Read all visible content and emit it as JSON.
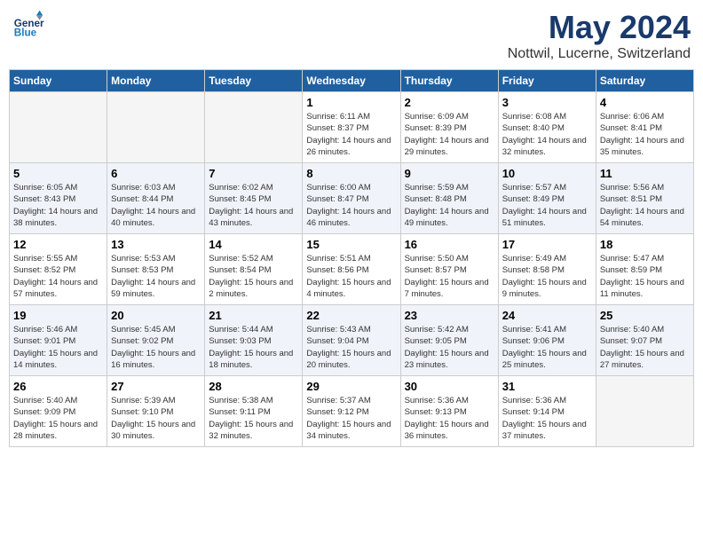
{
  "logo": {
    "general": "General",
    "blue": "Blue"
  },
  "title": "May 2024",
  "location": "Nottwil, Lucerne, Switzerland",
  "weekdays": [
    "Sunday",
    "Monday",
    "Tuesday",
    "Wednesday",
    "Thursday",
    "Friday",
    "Saturday"
  ],
  "weeks": [
    [
      {
        "day": "",
        "empty": true
      },
      {
        "day": "",
        "empty": true
      },
      {
        "day": "",
        "empty": true
      },
      {
        "day": "1",
        "info": "Sunrise: 6:11 AM\nSunset: 8:37 PM\nDaylight: 14 hours\nand 26 minutes."
      },
      {
        "day": "2",
        "info": "Sunrise: 6:09 AM\nSunset: 8:39 PM\nDaylight: 14 hours\nand 29 minutes."
      },
      {
        "day": "3",
        "info": "Sunrise: 6:08 AM\nSunset: 8:40 PM\nDaylight: 14 hours\nand 32 minutes."
      },
      {
        "day": "4",
        "info": "Sunrise: 6:06 AM\nSunset: 8:41 PM\nDaylight: 14 hours\nand 35 minutes."
      }
    ],
    [
      {
        "day": "5",
        "info": "Sunrise: 6:05 AM\nSunset: 8:43 PM\nDaylight: 14 hours\nand 38 minutes."
      },
      {
        "day": "6",
        "info": "Sunrise: 6:03 AM\nSunset: 8:44 PM\nDaylight: 14 hours\nand 40 minutes."
      },
      {
        "day": "7",
        "info": "Sunrise: 6:02 AM\nSunset: 8:45 PM\nDaylight: 14 hours\nand 43 minutes."
      },
      {
        "day": "8",
        "info": "Sunrise: 6:00 AM\nSunset: 8:47 PM\nDaylight: 14 hours\nand 46 minutes."
      },
      {
        "day": "9",
        "info": "Sunrise: 5:59 AM\nSunset: 8:48 PM\nDaylight: 14 hours\nand 49 minutes."
      },
      {
        "day": "10",
        "info": "Sunrise: 5:57 AM\nSunset: 8:49 PM\nDaylight: 14 hours\nand 51 minutes."
      },
      {
        "day": "11",
        "info": "Sunrise: 5:56 AM\nSunset: 8:51 PM\nDaylight: 14 hours\nand 54 minutes."
      }
    ],
    [
      {
        "day": "12",
        "info": "Sunrise: 5:55 AM\nSunset: 8:52 PM\nDaylight: 14 hours\nand 57 minutes."
      },
      {
        "day": "13",
        "info": "Sunrise: 5:53 AM\nSunset: 8:53 PM\nDaylight: 14 hours\nand 59 minutes."
      },
      {
        "day": "14",
        "info": "Sunrise: 5:52 AM\nSunset: 8:54 PM\nDaylight: 15 hours\nand 2 minutes."
      },
      {
        "day": "15",
        "info": "Sunrise: 5:51 AM\nSunset: 8:56 PM\nDaylight: 15 hours\nand 4 minutes."
      },
      {
        "day": "16",
        "info": "Sunrise: 5:50 AM\nSunset: 8:57 PM\nDaylight: 15 hours\nand 7 minutes."
      },
      {
        "day": "17",
        "info": "Sunrise: 5:49 AM\nSunset: 8:58 PM\nDaylight: 15 hours\nand 9 minutes."
      },
      {
        "day": "18",
        "info": "Sunrise: 5:47 AM\nSunset: 8:59 PM\nDaylight: 15 hours\nand 11 minutes."
      }
    ],
    [
      {
        "day": "19",
        "info": "Sunrise: 5:46 AM\nSunset: 9:01 PM\nDaylight: 15 hours\nand 14 minutes."
      },
      {
        "day": "20",
        "info": "Sunrise: 5:45 AM\nSunset: 9:02 PM\nDaylight: 15 hours\nand 16 minutes."
      },
      {
        "day": "21",
        "info": "Sunrise: 5:44 AM\nSunset: 9:03 PM\nDaylight: 15 hours\nand 18 minutes."
      },
      {
        "day": "22",
        "info": "Sunrise: 5:43 AM\nSunset: 9:04 PM\nDaylight: 15 hours\nand 20 minutes."
      },
      {
        "day": "23",
        "info": "Sunrise: 5:42 AM\nSunset: 9:05 PM\nDaylight: 15 hours\nand 23 minutes."
      },
      {
        "day": "24",
        "info": "Sunrise: 5:41 AM\nSunset: 9:06 PM\nDaylight: 15 hours\nand 25 minutes."
      },
      {
        "day": "25",
        "info": "Sunrise: 5:40 AM\nSunset: 9:07 PM\nDaylight: 15 hours\nand 27 minutes."
      }
    ],
    [
      {
        "day": "26",
        "info": "Sunrise: 5:40 AM\nSunset: 9:09 PM\nDaylight: 15 hours\nand 28 minutes."
      },
      {
        "day": "27",
        "info": "Sunrise: 5:39 AM\nSunset: 9:10 PM\nDaylight: 15 hours\nand 30 minutes."
      },
      {
        "day": "28",
        "info": "Sunrise: 5:38 AM\nSunset: 9:11 PM\nDaylight: 15 hours\nand 32 minutes."
      },
      {
        "day": "29",
        "info": "Sunrise: 5:37 AM\nSunset: 9:12 PM\nDaylight: 15 hours\nand 34 minutes."
      },
      {
        "day": "30",
        "info": "Sunrise: 5:36 AM\nSunset: 9:13 PM\nDaylight: 15 hours\nand 36 minutes."
      },
      {
        "day": "31",
        "info": "Sunrise: 5:36 AM\nSunset: 9:14 PM\nDaylight: 15 hours\nand 37 minutes."
      },
      {
        "day": "",
        "empty": true
      }
    ]
  ]
}
